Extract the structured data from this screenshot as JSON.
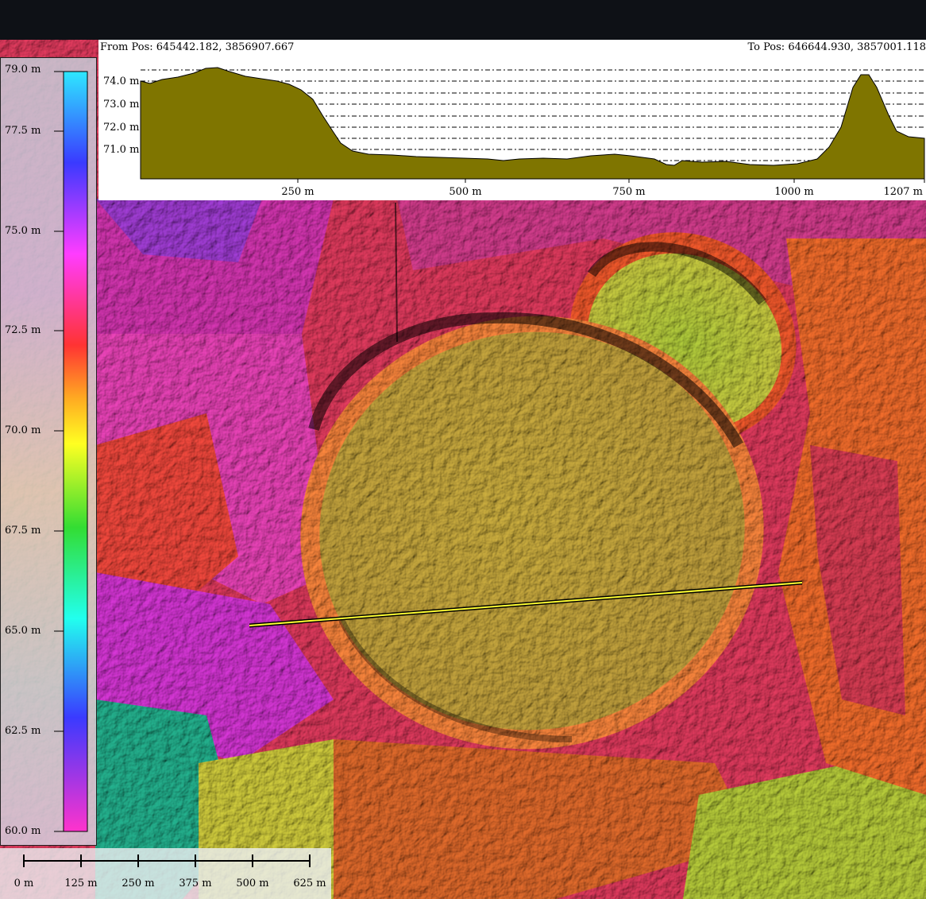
{
  "profile": {
    "from_label": "From Pos:",
    "from_coords": "645442.182, 3856907.667",
    "to_label": "To Pos:",
    "to_coords": "646644.930, 3857001.118",
    "distance_ticks": [
      "250 m",
      "500 m",
      "750 m",
      "1000 m",
      "1207 m"
    ],
    "elevation_ticks": [
      "74.0 m",
      "73.0 m",
      "72.0 m",
      "71.0 m"
    ],
    "fill_color": "#7f7500"
  },
  "legend": {
    "labels": [
      "79.0 m",
      "77.5 m",
      "75.0 m",
      "72.5 m",
      "70.0 m",
      "67.5 m",
      "65.0 m",
      "62.5 m",
      "60.0 m"
    ],
    "gradient_colors": [
      "#2ee8ff",
      "#3a3aff",
      "#ff3cff",
      "#ff3333",
      "#ffaa22",
      "#ffff22",
      "#33dd33",
      "#22ffee",
      "#3a3aff",
      "#ff33cc"
    ]
  },
  "scalebar": {
    "labels": [
      "0 m",
      "125 m",
      "250 m",
      "375 m",
      "500 m",
      "625 m"
    ]
  },
  "map": {
    "profile_line_color": "#ffff33",
    "icons": [
      "elevation-hillshade-map"
    ]
  }
}
